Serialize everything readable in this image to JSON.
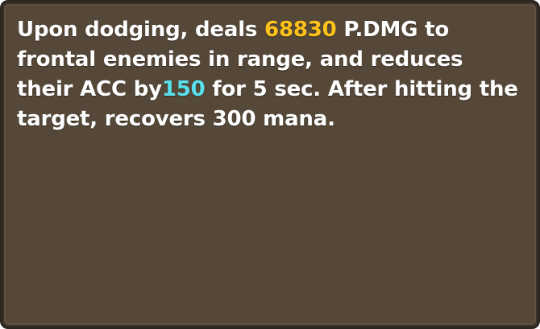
{
  "tooltip": {
    "segments": {
      "s1": "Upon dodging, deals ",
      "dmg_value": "68830",
      "s2": " P.DMG to frontal enemies in range, and reduces their ACC by",
      "acc_value": "150",
      "s3": " for 5 sec. After hitting the target, recovers 300 mana."
    },
    "colors": {
      "background": "#554838",
      "border": "#2b2620",
      "text": "#ffffff",
      "damage_highlight": "#ffc21a",
      "acc_highlight": "#59e1ee"
    }
  }
}
